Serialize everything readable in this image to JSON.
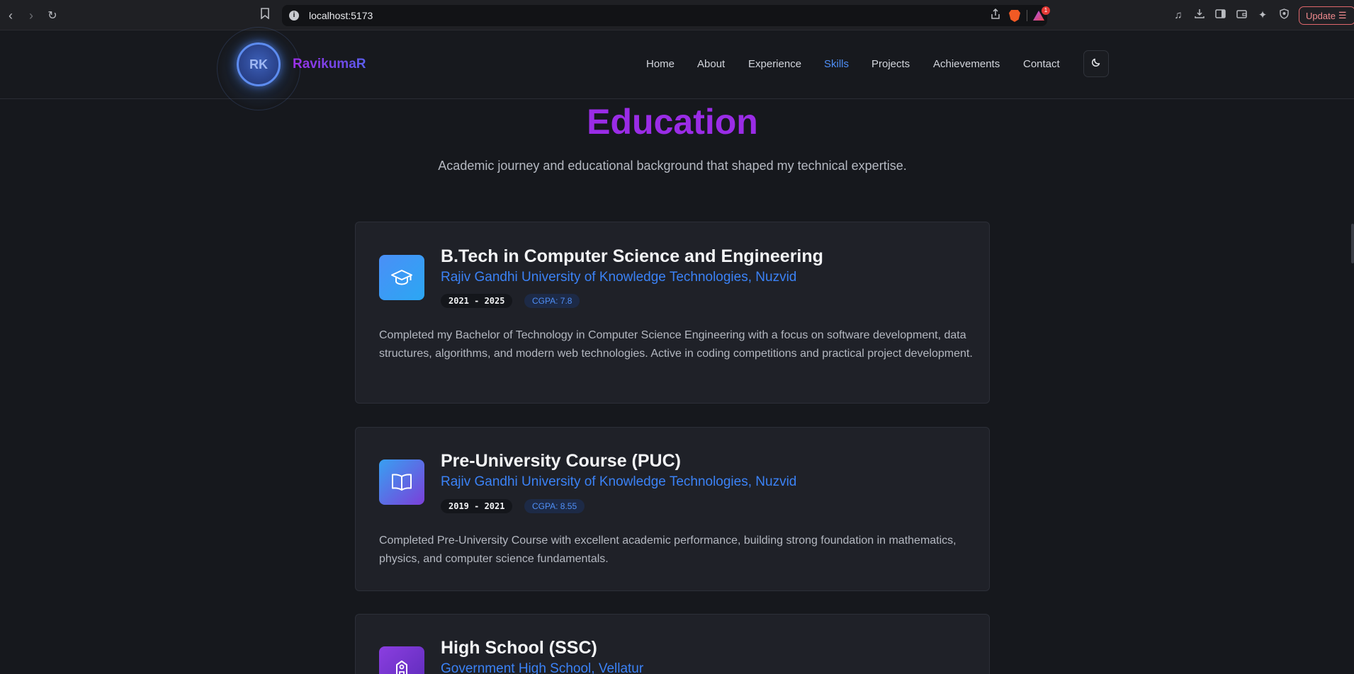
{
  "browser": {
    "url": "localhost:5173",
    "rewards_badge": "1",
    "update_label": "Update"
  },
  "site": {
    "logo_initials": "RK",
    "brand": "RavikumaR",
    "nav": {
      "home": "Home",
      "about": "About",
      "experience": "Experience",
      "skills": "Skills",
      "projects": "Projects",
      "achievements": "Achievements",
      "contact": "Contact"
    },
    "active_nav": "Skills"
  },
  "section": {
    "title": "Education",
    "subtitle": "Academic journey and educational background that shaped my technical expertise."
  },
  "education": [
    {
      "icon": "graduation-cap-icon",
      "title": "B.Tech in Computer Science and Engineering",
      "institution": "Rajiv Gandhi University of Knowledge Technologies, Nuzvid",
      "years": "2021 - 2025",
      "grade": "CGPA: 7.8",
      "description": "Completed my Bachelor of Technology in Computer Science Engineering with a focus on software development, data structures, algorithms, and modern web technologies. Active in coding competitions and practical project development."
    },
    {
      "icon": "book-open-icon",
      "title": "Pre-University Course (PUC)",
      "institution": "Rajiv Gandhi University of Knowledge Technologies, Nuzvid",
      "years": "2019 - 2021",
      "grade": "CGPA: 8.55",
      "description": "Completed Pre-University Course with excellent academic performance, building strong foundation in mathematics, physics, and computer science fundamentals."
    },
    {
      "icon": "school-icon",
      "title": "High School (SSC)",
      "institution": "Government High School, Vellatur"
    }
  ]
}
